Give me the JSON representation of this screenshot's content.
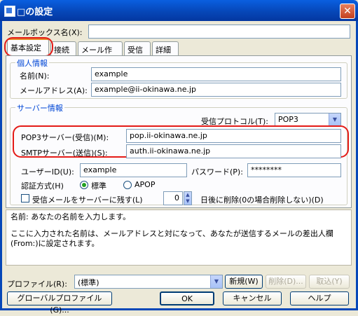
{
  "window": {
    "title": "□の設定",
    "close_glyph": "✕"
  },
  "mailbox_name": {
    "label": "メールボックス名(X):",
    "value": ""
  },
  "tabs": [
    {
      "label": "基本設定",
      "active": true
    },
    {
      "label": "接続"
    },
    {
      "label": "メール作成"
    },
    {
      "label": "受信"
    },
    {
      "label": "詳細"
    }
  ],
  "personal": {
    "legend": "個人情報",
    "name_label": "名前(N):",
    "name_value": "example",
    "email_label": "メールアドレス(A):",
    "email_value": "example@ii-okinawa.ne.jp"
  },
  "server": {
    "legend": "サーバー情報",
    "protocol_label": "受信プロトコル(T):",
    "protocol_value": "POP3",
    "pop3_label": "POP3サーバー(受信)(M):",
    "pop3_value": "pop.ii-okinawa.ne.jp",
    "smtp_label": "SMTPサーバー(送信)(S):",
    "smtp_value": "auth.ii-okinawa.ne.jp",
    "userid_label": "ユーザーID(U):",
    "userid_value": "example",
    "password_label": "パスワード(P):",
    "password_value": "********",
    "auth_label": "認証方式(H)",
    "auth_options": [
      "標準",
      "APOP"
    ],
    "leave_label": "受信メールをサーバーに残す(L)",
    "days_value": "0",
    "days_suffix": "日後に削除(0の場合削除しない)(D)"
  },
  "description": {
    "line1": "名前: あなたの名前を入力します。",
    "line2": "ここに入力された名前は、メールアドレスと対になって、あなたが送信するメールの差出人欄(From:)に設定されます。"
  },
  "profile": {
    "label": "プロファイル(R):",
    "value": "(標準)",
    "new_button": "新規(W)",
    "delete_button": "削除(D)...",
    "cancel_button": "取込(Y)"
  },
  "bottom": {
    "global_profile": "グローバルプロファイル(G)...",
    "ok": "OK",
    "cancel": "キャンセル",
    "help": "ヘルプ"
  },
  "accent": {
    "highlight": "#e41b17",
    "legend_blue": "#0046d5"
  }
}
